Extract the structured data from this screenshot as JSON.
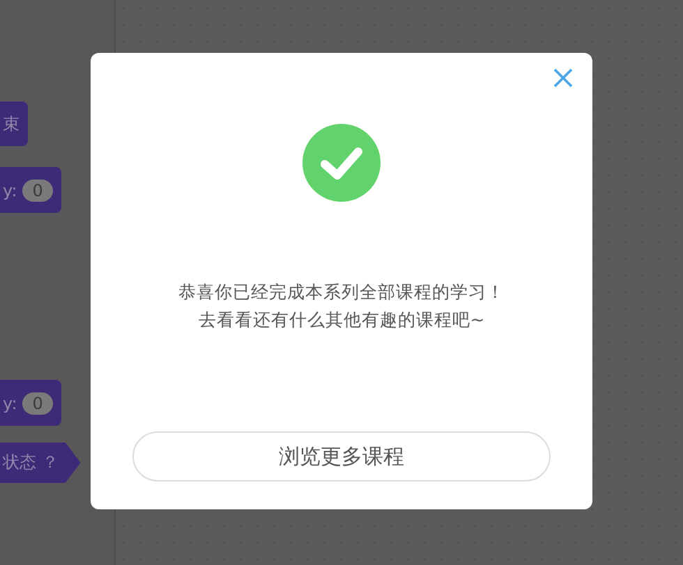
{
  "editor": {
    "blocks": [
      {
        "kind": "label",
        "text": "束"
      },
      {
        "kind": "coordinate",
        "label": "y:",
        "value": "0"
      },
      {
        "kind": "coordinate",
        "label": "y:",
        "value": "0"
      },
      {
        "kind": "boolean",
        "text": "状态 ？"
      }
    ]
  },
  "dialog": {
    "message": [
      "恭喜你已经完成本系列全部课程的学习！",
      "去看看还有什么其他有趣的课程吧~"
    ],
    "button": "浏览更多课程"
  }
}
